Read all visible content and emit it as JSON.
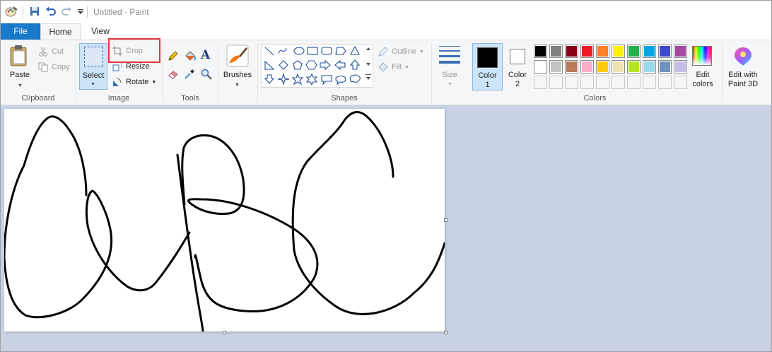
{
  "window": {
    "title": "Untitled - Paint"
  },
  "quick_access": [
    "save-icon",
    "undo-icon",
    "redo-icon",
    "customize-icon"
  ],
  "tabs": [
    {
      "label": "File"
    },
    {
      "label": "Home"
    },
    {
      "label": "View"
    }
  ],
  "clipboard": {
    "paste": "Paste",
    "cut": "Cut",
    "copy": "Copy",
    "group": "Clipboard"
  },
  "image": {
    "select": "Select",
    "crop": "Crop",
    "resize": "Resize",
    "rotate": "Rotate",
    "group": "Image"
  },
  "tools": {
    "group": "Tools"
  },
  "brushes": {
    "label": "Brushes"
  },
  "shapes": {
    "outline": "Outline",
    "fill": "Fill",
    "group": "Shapes"
  },
  "size": {
    "label": "Size"
  },
  "colors": {
    "color1_label": "Color",
    "color1_num": "1",
    "color2_label": "Color",
    "color2_num": "2",
    "edit_colors_1": "Edit",
    "edit_colors_2": "colors",
    "group": "Colors",
    "palette_row1": [
      "#000000",
      "#7f7f7f",
      "#880015",
      "#ed1c24",
      "#ff7f27",
      "#fff200",
      "#22b14c",
      "#00a2e8",
      "#3f48cc",
      "#a349a4"
    ],
    "palette_row2": [
      "#ffffff",
      "#c3c3c3",
      "#b97a57",
      "#ffaec9",
      "#ffc90e",
      "#efe4b0",
      "#b5e61d",
      "#99d9ea",
      "#7092be",
      "#c8bfe7"
    ],
    "color1": "#000000",
    "color2": "#ffffff"
  },
  "paint3d": {
    "label_1": "Edit with",
    "label_2": "Paint 3D"
  }
}
